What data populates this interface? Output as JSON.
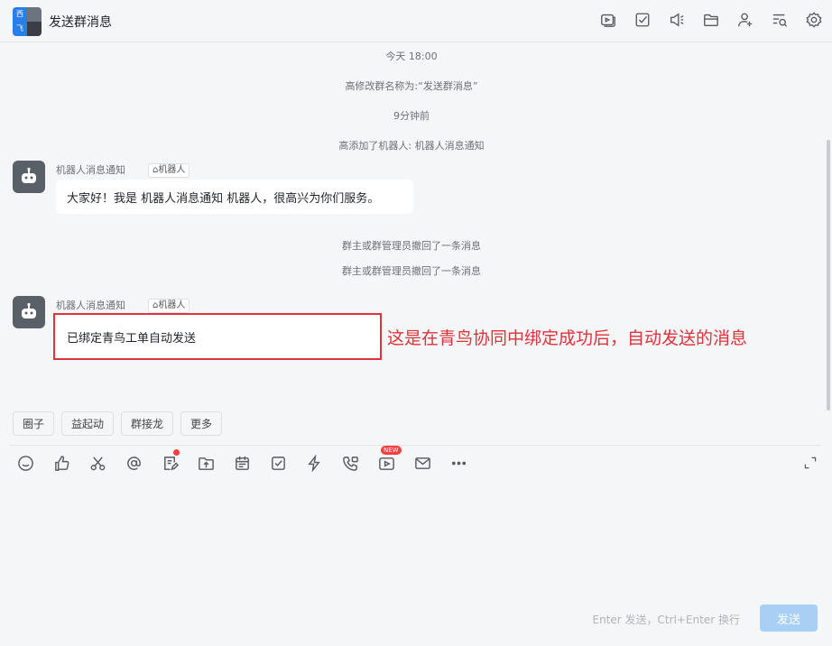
{
  "header": {
    "avatar_chars": [
      "西",
      "",
      "飞",
      ""
    ],
    "title": "发送群消息",
    "icons": [
      "screen-share-icon",
      "task-icon",
      "announcement-icon",
      "folder-icon",
      "add-member-icon",
      "search-history-icon",
      "settings-icon"
    ]
  },
  "messages": {
    "sys1": "今天 18:00",
    "sys2": "高修改群名称为:“发送群消息”",
    "sys3": "9分钟前",
    "sys4": "高添加了机器人: 机器人消息通知",
    "msg1": {
      "sender": "机器人消息通知",
      "tag": "机器人",
      "text": "大家好！我是 机器人消息通知 机器人，很高兴为你们服务。"
    },
    "sys5": "群主或群管理员撤回了一条消息",
    "sys6": "群主或群管理员撤回了一条消息",
    "msg2": {
      "sender": "机器人消息通知",
      "tag": "机器人",
      "text": "已绑定青鸟工单自动发送"
    },
    "annotation": "这是在青鸟协同中绑定成功后，自动发送的消息"
  },
  "chips": [
    "圈子",
    "益起动",
    "群接龙",
    "更多"
  ],
  "toolbar": {
    "new_badge": "NEW"
  },
  "composer": {
    "hint": "Enter 发送，Ctrl+Enter 换行",
    "send_label": "发送"
  },
  "colors": {
    "annotation_red": "#e0323a",
    "send_disabled": "#a8d0f5"
  }
}
